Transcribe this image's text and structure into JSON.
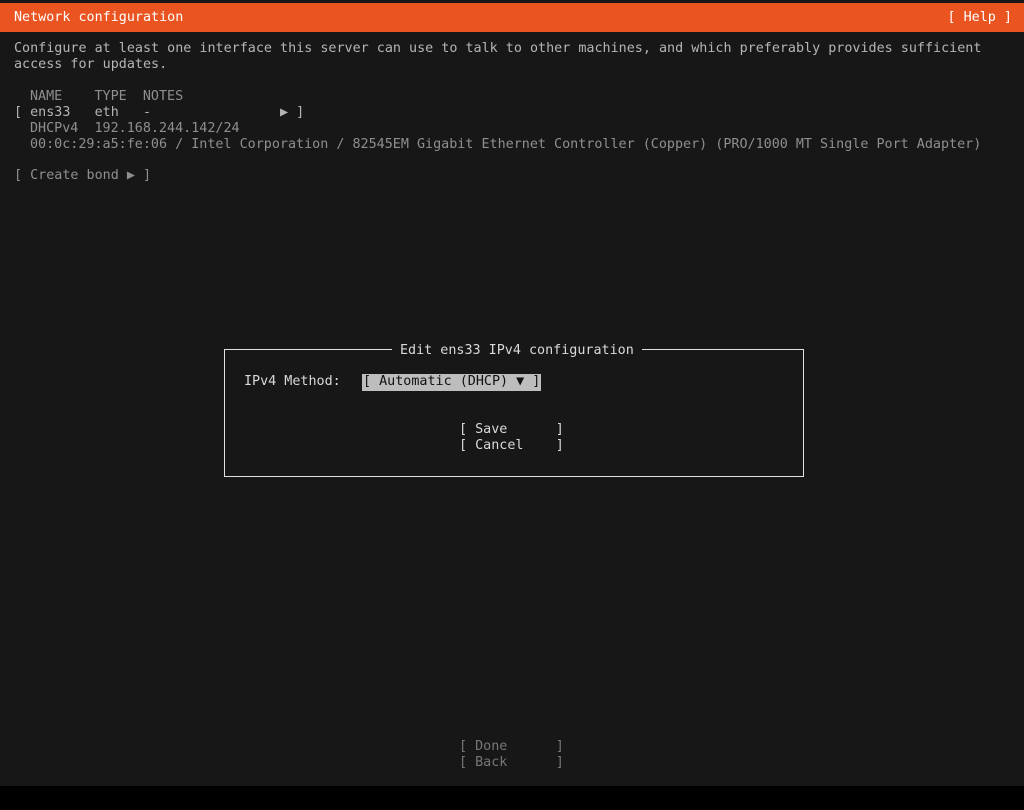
{
  "header": {
    "title": "Network configuration",
    "help_label": "[ Help ]"
  },
  "intro": {
    "line1": "Configure at least one interface this server can use to talk to other machines, and which preferably provides sufficient",
    "line2": "access for updates."
  },
  "table": {
    "columns": [
      "NAME",
      "TYPE",
      "NOTES"
    ],
    "columns_text": "NAME    TYPE  NOTES",
    "interface_row": "[ ens33   eth   -                ▶ ]",
    "dhcp_row": "DHCPv4  192.168.244.142/24",
    "hw_row": "00:0c:29:a5:fe:06 / Intel Corporation / 82545EM Gigabit Ethernet Controller (Copper) (PRO/1000 MT Single Port Adapter)"
  },
  "create_bond_label": "[ Create bond ▶ ]",
  "dialog": {
    "title": "Edit ens33 IPv4 configuration",
    "method_label": "IPv4 Method:",
    "method_value": "[ Automatic (DHCP) ▼ ]",
    "save_label": "[ Save      ]",
    "cancel_label": "[ Cancel    ]"
  },
  "footer": {
    "done_label": "[ Done      ]",
    "back_label": "[ Back      ]"
  },
  "colors": {
    "header_bg": "#e95420",
    "screen_bg": "#171717",
    "selected_bg": "#bdbdbd"
  }
}
